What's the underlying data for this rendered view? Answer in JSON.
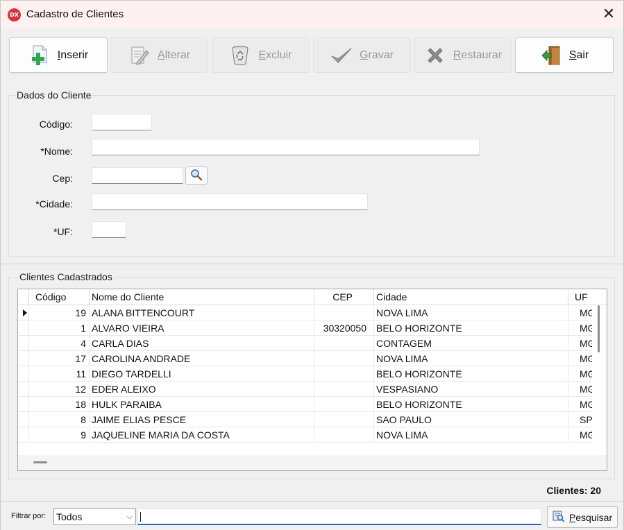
{
  "window": {
    "icon_text": "DX",
    "title": "Cadastro de Clientes",
    "close_glyph": "✕"
  },
  "toolbar": {
    "buttons": [
      {
        "label": "Inserir",
        "enabled": true,
        "icon": "add-document-icon"
      },
      {
        "label": "Alterar",
        "enabled": false,
        "icon": "edit-document-icon"
      },
      {
        "label": "Excluir",
        "enabled": false,
        "icon": "recycle-bin-icon"
      },
      {
        "label": "Gravar",
        "enabled": false,
        "icon": "checkmark-icon"
      },
      {
        "label": "Restaurar",
        "enabled": false,
        "icon": "x-cancel-icon"
      },
      {
        "label": "Sair",
        "enabled": true,
        "icon": "exit-door-icon"
      }
    ]
  },
  "dados": {
    "title": "Dados do Cliente",
    "codigo_label": "Código:",
    "nome_label": "*Nome:",
    "cep_label": "Cep:",
    "cidade_label": "*Cidade:",
    "uf_label": "*UF:",
    "codigo_value": "",
    "nome_value": "",
    "cep_value": "",
    "cidade_value": "",
    "uf_value": ""
  },
  "lista": {
    "title": "Clientes Cadastrados",
    "columns": [
      "Código",
      "Nome do Cliente",
      "CEP",
      "Cidade",
      "UF"
    ],
    "rows": [
      {
        "codigo": "19",
        "nome": "ALANA BITTENCOURT",
        "cep": "",
        "cidade": "NOVA LIMA",
        "uf": "MG",
        "current": true
      },
      {
        "codigo": "1",
        "nome": "ALVARO VIEIRA",
        "cep": "30320050",
        "cidade": "BELO HORIZONTE",
        "uf": "MG",
        "current": false
      },
      {
        "codigo": "4",
        "nome": "CARLA DIAS",
        "cep": "",
        "cidade": "CONTAGEM",
        "uf": "MG",
        "current": false
      },
      {
        "codigo": "17",
        "nome": "CAROLINA ANDRADE",
        "cep": "",
        "cidade": "NOVA LIMA",
        "uf": "MG",
        "current": false
      },
      {
        "codigo": "11",
        "nome": "DIEGO TARDELLI",
        "cep": "",
        "cidade": "BELO HORIZONTE",
        "uf": "MG",
        "current": false
      },
      {
        "codigo": "12",
        "nome": "EDER ALEIXO",
        "cep": "",
        "cidade": "VESPASIANO",
        "uf": "MG",
        "current": false
      },
      {
        "codigo": "18",
        "nome": "HULK PARAIBA",
        "cep": "",
        "cidade": "BELO HORIZONTE",
        "uf": "MG",
        "current": false
      },
      {
        "codigo": "8",
        "nome": "JAIME ELIAS PESCE",
        "cep": "",
        "cidade": "SAO PAULO",
        "uf": "SP",
        "current": false
      },
      {
        "codigo": "9",
        "nome": "JAQUELINE MARIA DA COSTA",
        "cep": "",
        "cidade": "NOVA LIMA",
        "uf": "MG",
        "current": false
      }
    ],
    "count_text": "Clientes: 20"
  },
  "filter": {
    "label": "Filtrar por:",
    "selected": "Todos",
    "value": "",
    "button_label": "Pesquisar"
  },
  "colors": {
    "title_bar": "#fff0f2",
    "icon_badge": "#d6343c",
    "accent_underline": "#1e63c3",
    "add_icon": "#2fa84f",
    "exit_icon": "#3a9a3a"
  }
}
